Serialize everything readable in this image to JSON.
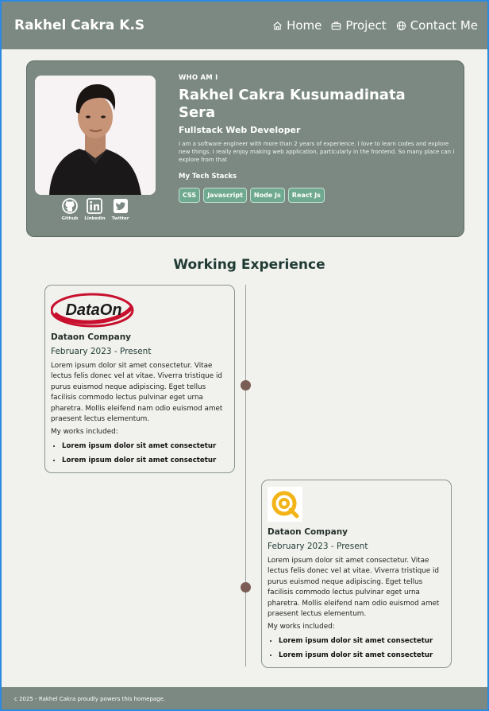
{
  "nav": {
    "brand": "Rakhel Cakra K.S",
    "links": [
      {
        "label": "Home",
        "icon": "home-icon"
      },
      {
        "label": "Project",
        "icon": "briefcase-icon"
      },
      {
        "label": "Contact Me",
        "icon": "globe-icon"
      }
    ]
  },
  "profile": {
    "eyebrow": "WHO AM I",
    "name": "Rakhel Cakra Kusumadinata Sera",
    "role": "Fullstack Web Developer",
    "bio": "I am a software engineer with more than 2 years of experience. I love to learn codes and explore new things. I really enjoy making web application, particularly in the frontend. So many place can i explore from  that",
    "stack_title": "My Tech Stacks",
    "tags": [
      "CSS",
      "Javascript",
      "Node Js",
      "React Js"
    ],
    "socials": [
      {
        "label": "Github",
        "icon": "github-icon"
      },
      {
        "label": "Linkedin",
        "icon": "linkedin-icon"
      },
      {
        "label": "Twitter",
        "icon": "twitter-icon"
      }
    ]
  },
  "experience": {
    "title": "Working Experience",
    "items": [
      {
        "logo_text": "DataOn",
        "company": "Dataon Company",
        "period": "February 2023 - Present",
        "description": "Lorem ipsum dolor sit amet consectetur. Vitae lectus felis donec vel at vitae. Viverra tristique id purus euismod neque adipiscing. Eget tellus facilisis commodo lectus pulvinar eget urna pharetra. Mollis eleifend nam odio euismod amet praesent lectus elementum.",
        "works_label": "My works included:",
        "works": [
          "Lorem ipsum dolor sit amet consectetur",
          "Lorem ipsum dolor sit amet consectetur"
        ]
      },
      {
        "logo_text": "",
        "company": "Dataon Company",
        "period": "February 2023 - Present",
        "description": "Lorem ipsum dolor sit amet consectetur. Vitae lectus felis donec vel at vitae. Viverra tristique id purus euismod neque adipiscing. Eget tellus facilisis commodo lectus pulvinar eget urna pharetra. Mollis eleifend nam odio euismod amet praesent lectus elementum.",
        "works_label": "My works included:",
        "works": [
          "Lorem ipsum dolor sit amet consectetur",
          "Lorem ipsum dolor sit amet consectetur"
        ]
      }
    ]
  },
  "footer": {
    "text": "c 2025 - Rakhel Cakra proudly powers this homepage."
  },
  "colors": {
    "nav_bg": "#7b8982",
    "page_bg": "#f1f2ee",
    "tag_bg": "#6fa98f",
    "heading": "#1f3a33",
    "timeline_dot": "#7a5d55",
    "dataon_red": "#c8102e",
    "logo_yellow": "#f2b418"
  }
}
